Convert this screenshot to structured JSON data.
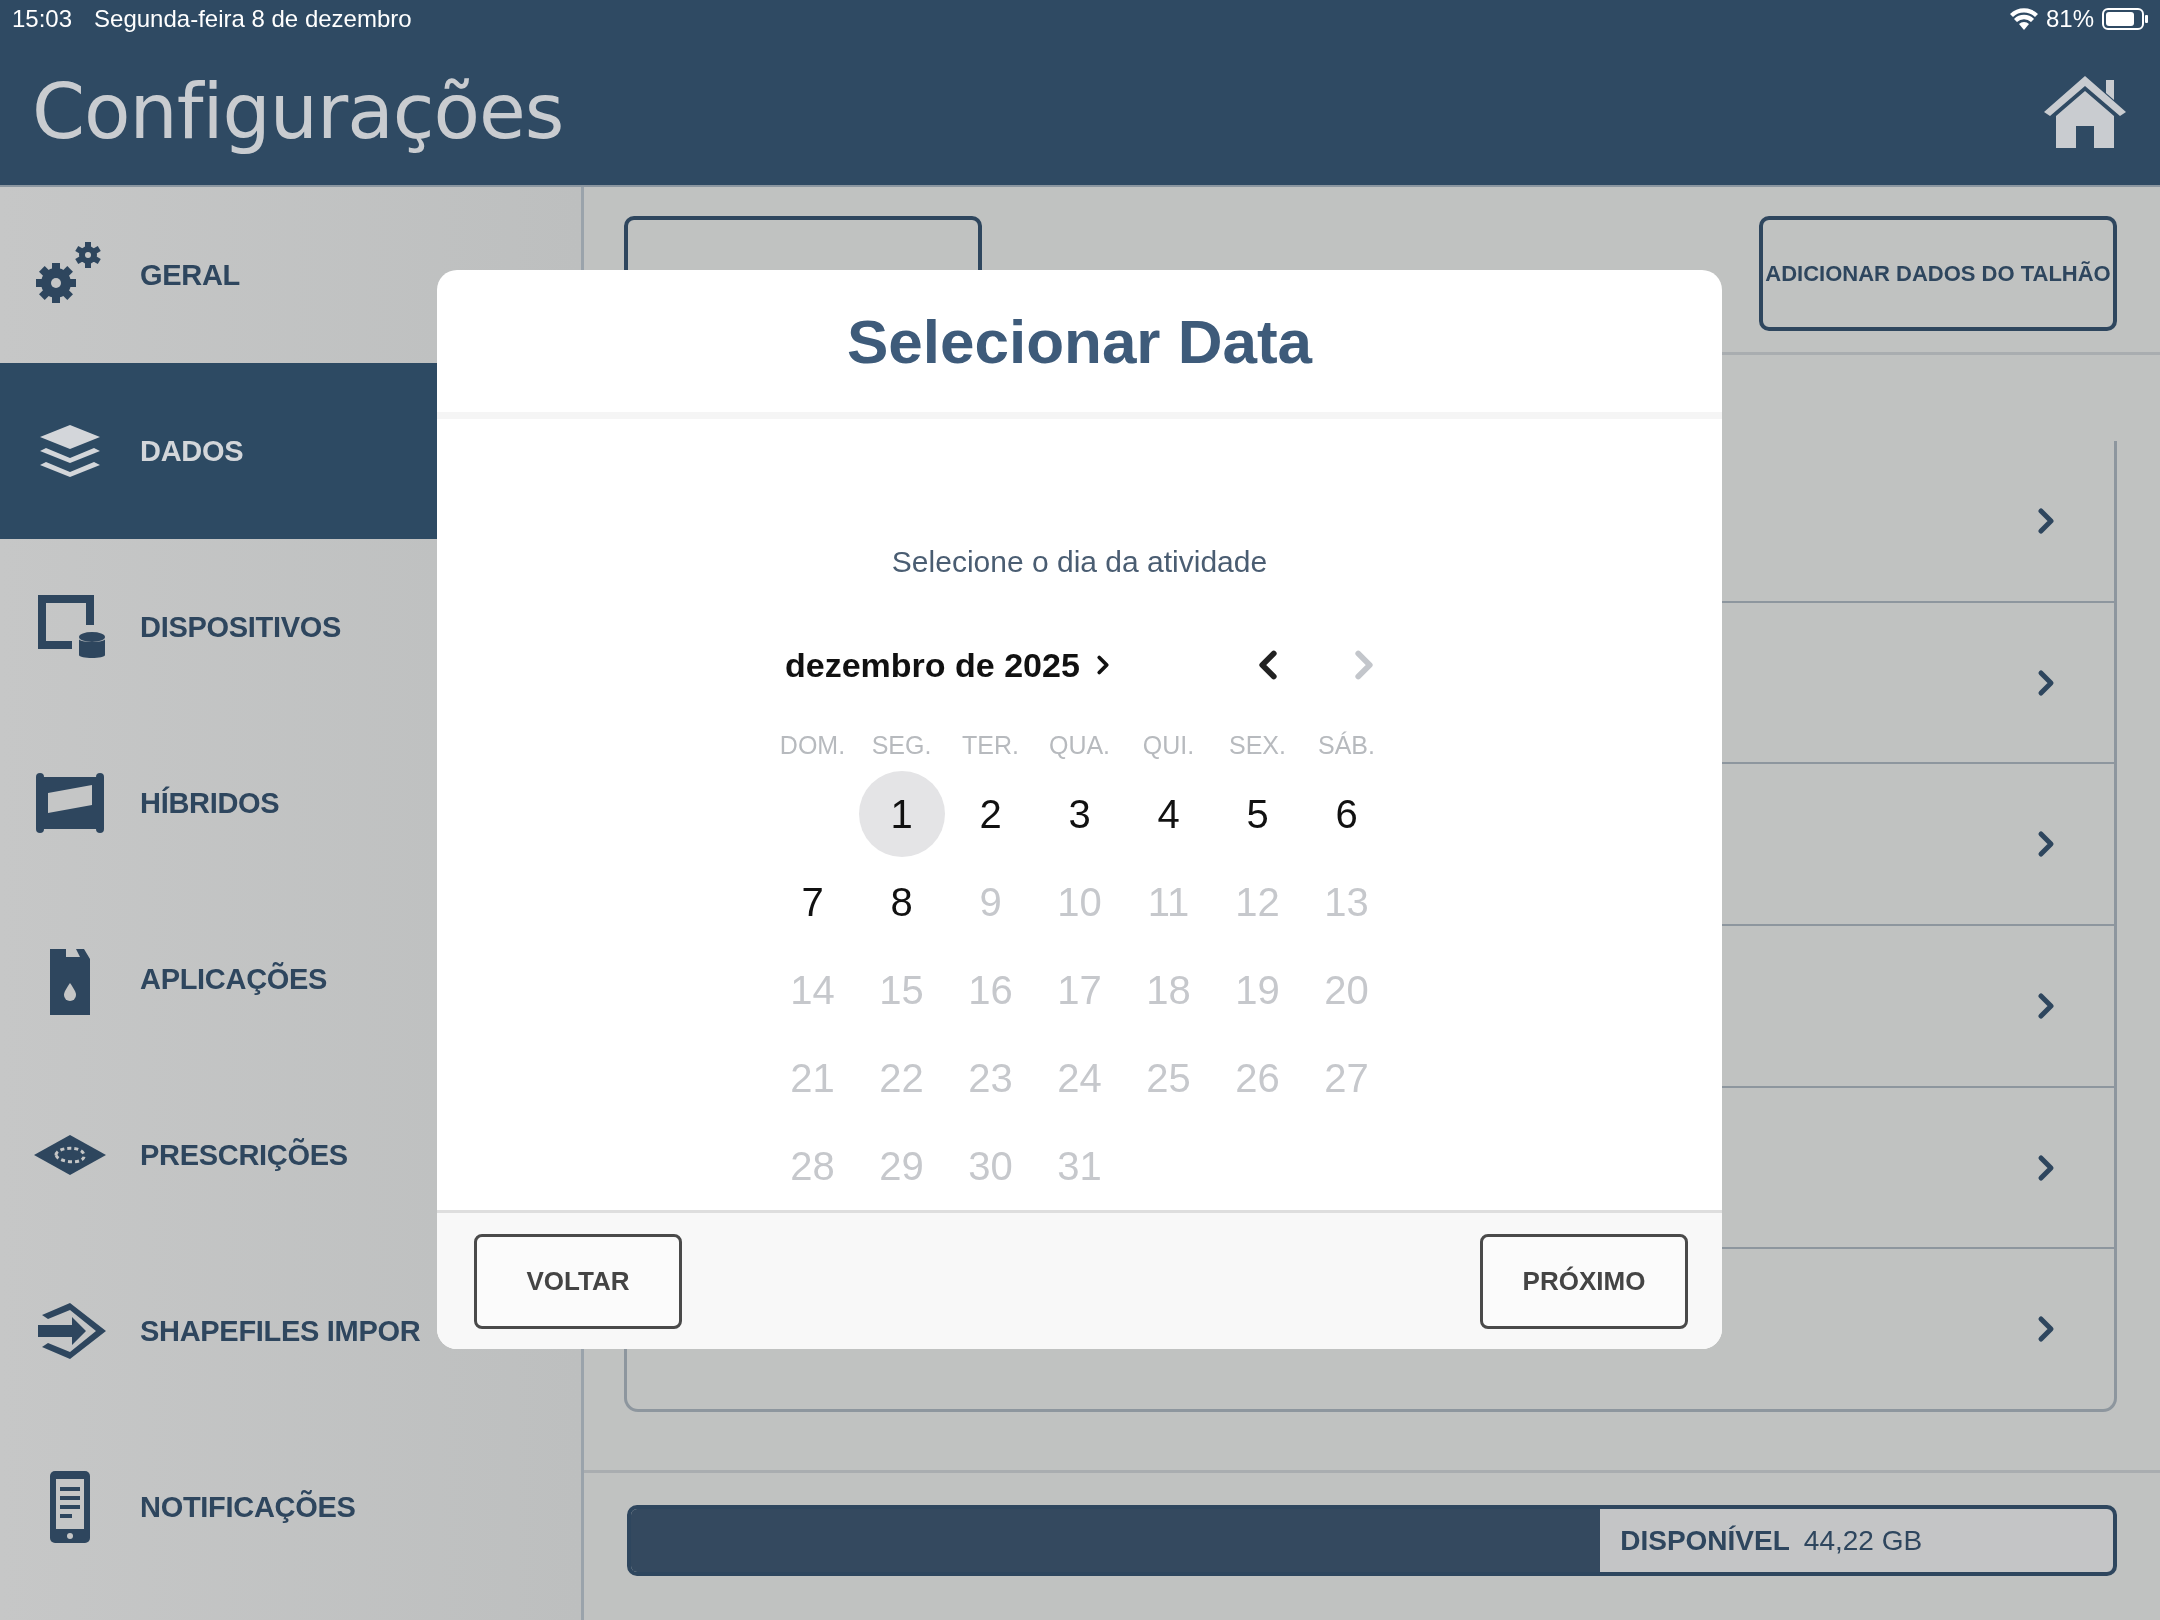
{
  "status_bar": {
    "time": "15:03",
    "date": "Segunda-feira 8 de dezembro",
    "battery": "81%"
  },
  "header": {
    "title": "Configurações"
  },
  "sidebar": {
    "items": [
      {
        "label": "GERAL",
        "selected": false
      },
      {
        "label": "DADOS",
        "selected": true
      },
      {
        "label": "DISPOSITIVOS",
        "selected": false
      },
      {
        "label": "HÍBRIDOS",
        "selected": false
      },
      {
        "label": "APLICAÇÕES",
        "selected": false
      },
      {
        "label": "PRESCRIÇÕES",
        "selected": false
      },
      {
        "label": "SHAPEFILES IMPOR",
        "selected": false
      },
      {
        "label": "NOTIFICAÇÕES",
        "selected": false
      }
    ]
  },
  "content": {
    "add_button": "ADICIONAR DADOS DO TALHÃO",
    "storage": {
      "label": "DISPONÍVEL",
      "value": "44,22 GB",
      "level": 0.654
    }
  },
  "dialog": {
    "title": "Selecionar Data",
    "subtitle": "Selecione o dia da atividade",
    "month": "dezembro de 2025",
    "prev_disabled": false,
    "next_disabled": true,
    "weekdays": [
      "DOM.",
      "SEG.",
      "TER.",
      "QUA.",
      "QUI.",
      "SEX.",
      "SÁB."
    ],
    "weeks": [
      {
        "days": [
          {
            "label": "1",
            "selected": true,
            "disabled": false
          },
          {
            "label": "2",
            "selected": false,
            "disabled": false
          },
          {
            "label": "3",
            "selected": false,
            "disabled": false
          },
          {
            "label": "4",
            "selected": false,
            "disabled": false
          },
          {
            "label": "5",
            "selected": false,
            "disabled": false
          },
          {
            "label": "6",
            "selected": false,
            "disabled": false
          }
        ]
      },
      {
        "days": [
          {
            "label": "7",
            "selected": false,
            "disabled": false
          },
          {
            "label": "8",
            "selected": false,
            "disabled": false
          },
          {
            "label": "9",
            "selected": false,
            "disabled": true
          },
          {
            "label": "10",
            "selected": false,
            "disabled": true
          },
          {
            "label": "11",
            "selected": false,
            "disabled": true
          },
          {
            "label": "12",
            "selected": false,
            "disabled": true
          },
          {
            "label": "13",
            "selected": false,
            "disabled": true
          }
        ]
      },
      {
        "days": [
          {
            "label": "14",
            "selected": false,
            "disabled": true
          },
          {
            "label": "15",
            "selected": false,
            "disabled": true
          },
          {
            "label": "16",
            "selected": false,
            "disabled": true
          },
          {
            "label": "17",
            "selected": false,
            "disabled": true
          },
          {
            "label": "18",
            "selected": false,
            "disabled": true
          },
          {
            "label": "19",
            "selected": false,
            "disabled": true
          },
          {
            "label": "20",
            "selected": false,
            "disabled": true
          }
        ]
      },
      {
        "days": [
          {
            "label": "21",
            "selected": false,
            "disabled": true
          },
          {
            "label": "22",
            "selected": false,
            "disabled": true
          },
          {
            "label": "23",
            "selected": false,
            "disabled": true
          },
          {
            "label": "24",
            "selected": false,
            "disabled": true
          },
          {
            "label": "25",
            "selected": false,
            "disabled": true
          },
          {
            "label": "26",
            "selected": false,
            "disabled": true
          },
          {
            "label": "27",
            "selected": false,
            "disabled": true
          }
        ]
      },
      {
        "days": [
          {
            "label": "28",
            "selected": false,
            "disabled": true
          },
          {
            "label": "29",
            "selected": false,
            "disabled": true
          },
          {
            "label": "30",
            "selected": false,
            "disabled": true
          },
          {
            "label": "31",
            "selected": false,
            "disabled": true
          }
        ]
      }
    ],
    "back_button": "VOLTAR",
    "next_button": "PRÓXIMO"
  }
}
